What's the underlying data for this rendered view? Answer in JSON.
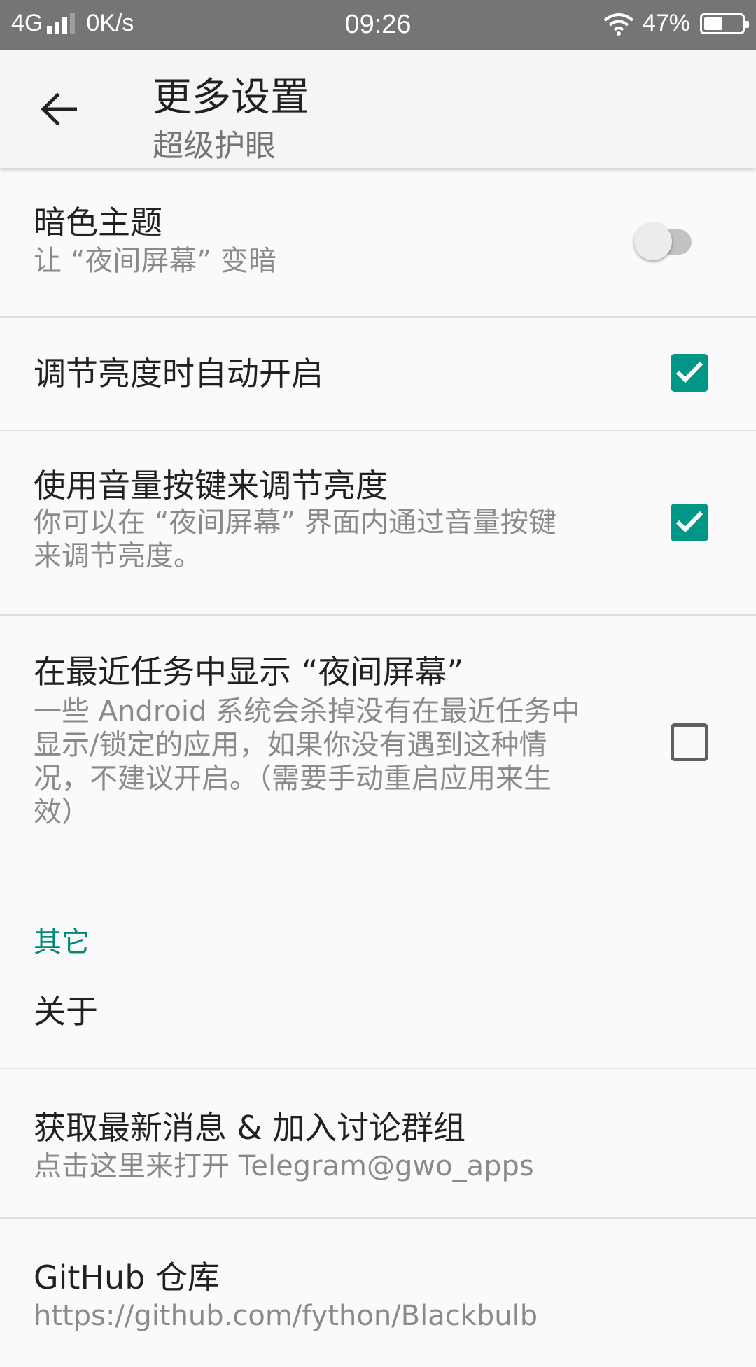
{
  "status_bar": {
    "network": "4G",
    "speed": "0K/s",
    "time": "09:26",
    "battery": "47%",
    "battery_level": 0.47
  },
  "app_bar": {
    "title": "更多设置",
    "subtitle": "超级护眼"
  },
  "settings": {
    "dark_theme": {
      "title": "暗色主题",
      "summary": "让 “夜间屏幕” 变暗",
      "enabled": false
    },
    "auto_enable": {
      "title": "调节亮度时自动开启",
      "checked": true
    },
    "volume_keys": {
      "title": "使用音量按键来调节亮度",
      "summary_line1": "你可以在 “夜间屏幕” 界面内通过音量按键",
      "summary_line2": "来调节亮度。",
      "checked": true
    },
    "recent_tasks": {
      "title": "在最近任务中显示 “夜间屏幕”",
      "summary_line1": "一些 Android 系统会杀掉没有在最近任务中",
      "summary_line2": "显示/锁定的应用，如果你没有遇到这种情",
      "summary_line3": "况，不建议开启。（需要手动重启应用来生",
      "summary_line4": "效）",
      "checked": false
    }
  },
  "other": {
    "header": "其它",
    "about": {
      "title": "关于"
    },
    "news": {
      "title": "获取最新消息 & 加入讨论群组",
      "summary": "点击这里来打开 Telegram@gwo_apps"
    },
    "github": {
      "title": "GitHub 仓库",
      "summary": "https://github.com/fython/Blackbulb"
    }
  },
  "colors": {
    "accent": "#009688",
    "status_bar": "#757575"
  }
}
